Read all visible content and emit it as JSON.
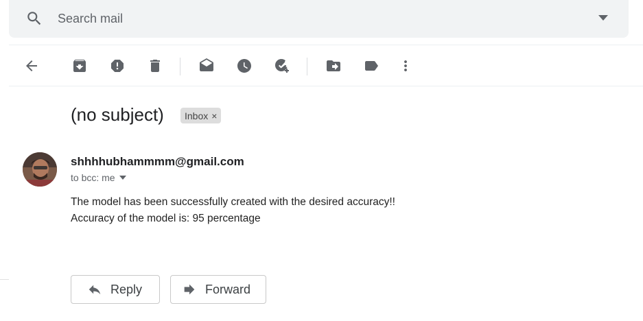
{
  "search": {
    "placeholder": "Search mail"
  },
  "toolbar": {
    "icons": [
      "back-arrow-icon",
      "archive-icon",
      "report-spam-icon",
      "delete-icon",
      "mark-unread-icon",
      "snooze-icon",
      "add-to-tasks-icon",
      "move-to-icon",
      "label-icon",
      "more-vertical-icon"
    ]
  },
  "email": {
    "subject": "(no subject)",
    "label": "Inbox",
    "label_close": "×",
    "sender": "shhhhubhammmm@gmail.com",
    "recipients": "to bcc: me",
    "body_line1": "The model has been successfully created with the desired accuracy!!",
    "body_line2": "Accuracy of the model is: 95 percentage"
  },
  "actions": {
    "reply": "Reply",
    "forward": "Forward"
  },
  "colors": {
    "icon": "#5f6368",
    "search_bg": "#f1f3f4",
    "chip_bg": "#dddddd"
  }
}
